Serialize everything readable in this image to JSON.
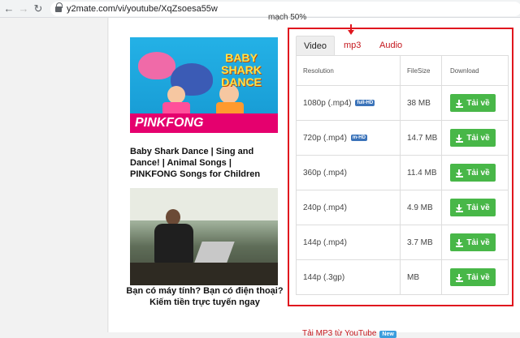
{
  "browser": {
    "back_icon": "arrow-left-icon",
    "forward_icon": "arrow-right-icon",
    "reload_icon": "reload-icon",
    "url": "y2mate.com/vi/youtube/XqZsoesa55w"
  },
  "page": {
    "top_cut_text": "mạch    50%"
  },
  "videos": [
    {
      "title": "Baby Shark Dance | Sing and Dance! | Animal Songs | PINKFONG Songs for Children",
      "thumb_title": "BABY SHARK DANCE",
      "thumb_brand": "PINKFONG"
    },
    {
      "title": "Bạn có máy tính? Bạn có điện thoại? Kiếm tiền trực tuyến ngay"
    }
  ],
  "download_panel": {
    "tabs": [
      {
        "label": "Video",
        "active": true
      },
      {
        "label": "mp3",
        "active": false
      },
      {
        "label": "Audio",
        "active": false
      }
    ],
    "headers": {
      "resolution": "Resolution",
      "filesize": "FileSize",
      "download": "Download"
    },
    "button_label": "Tải về",
    "rows": [
      {
        "resolution": "1080p (.mp4)",
        "badge": "full-HD",
        "size": "38 MB"
      },
      {
        "resolution": "720p (.mp4)",
        "badge": "m-HD",
        "size": "14.7 MB"
      },
      {
        "resolution": "360p (.mp4)",
        "badge": "",
        "size": "11.4 MB"
      },
      {
        "resolution": "240p (.mp4)",
        "badge": "",
        "size": "4.9 MB"
      },
      {
        "resolution": "144p (.mp4)",
        "badge": "",
        "size": "3.7 MB"
      },
      {
        "resolution": "144p (.3gp)",
        "badge": "",
        "size": "MB"
      }
    ]
  },
  "footer_link": {
    "label": "Tải MP3 từ YouTube",
    "badge": "New"
  },
  "colors": {
    "accent_red": "#e0161e",
    "download_green": "#48b748",
    "badge_blue": "#3b73b9"
  }
}
